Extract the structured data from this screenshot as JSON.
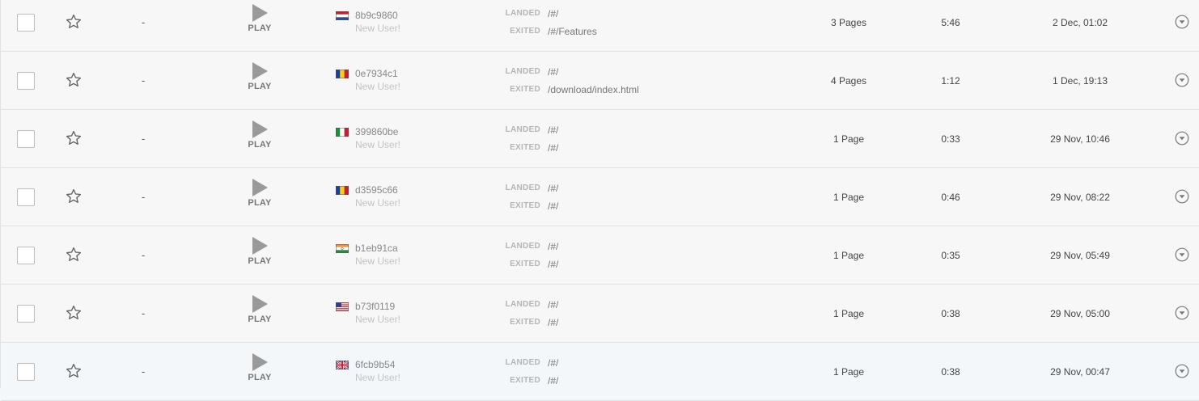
{
  "colors": {
    "row_bg": "#f7f7f7",
    "row_highlight_bg": "#f3f7fa",
    "border": "#e2e2e2",
    "play_icon": "#9a9a9a"
  },
  "icons": {
    "favorite": "star-outline-icon",
    "play": "play-triangle-icon",
    "expand": "chevron-down-circle-icon"
  },
  "labels": {
    "play": "PLAY",
    "landed": "LANDED",
    "exited": "EXITED"
  },
  "sessions": [
    {
      "name": "-",
      "flag": "netherlands",
      "user_id": "8b9c9860",
      "user_type": "New User!",
      "landed": "/#/",
      "exited": "/#/Features",
      "pages": "3 Pages",
      "duration": "5:46",
      "date": "2 Dec, 01:02"
    },
    {
      "name": "-",
      "flag": "romania",
      "user_id": "0e7934c1",
      "user_type": "New User!",
      "landed": "/#/",
      "exited": "/download/index.html",
      "pages": "4 Pages",
      "duration": "1:12",
      "date": "1 Dec, 19:13"
    },
    {
      "name": "-",
      "flag": "italy",
      "user_id": "399860be",
      "user_type": "New User!",
      "landed": "/#/",
      "exited": "/#/",
      "pages": "1 Page",
      "duration": "0:33",
      "date": "29 Nov, 10:46"
    },
    {
      "name": "-",
      "flag": "romania",
      "user_id": "d3595c66",
      "user_type": "New User!",
      "landed": "/#/",
      "exited": "/#/",
      "pages": "1 Page",
      "duration": "0:46",
      "date": "29 Nov, 08:22"
    },
    {
      "name": "-",
      "flag": "india",
      "user_id": "b1eb91ca",
      "user_type": "New User!",
      "landed": "/#/",
      "exited": "/#/",
      "pages": "1 Page",
      "duration": "0:35",
      "date": "29 Nov, 05:49"
    },
    {
      "name": "-",
      "flag": "united-states",
      "user_id": "b73f0119",
      "user_type": "New User!",
      "landed": "/#/",
      "exited": "/#/",
      "pages": "1 Page",
      "duration": "0:38",
      "date": "29 Nov, 05:00"
    },
    {
      "name": "-",
      "flag": "united-kingdom",
      "user_id": "6fcb9b54",
      "user_type": "New User!",
      "landed": "/#/",
      "exited": "/#/",
      "pages": "1 Page",
      "duration": "0:38",
      "date": "29 Nov, 00:47"
    }
  ]
}
